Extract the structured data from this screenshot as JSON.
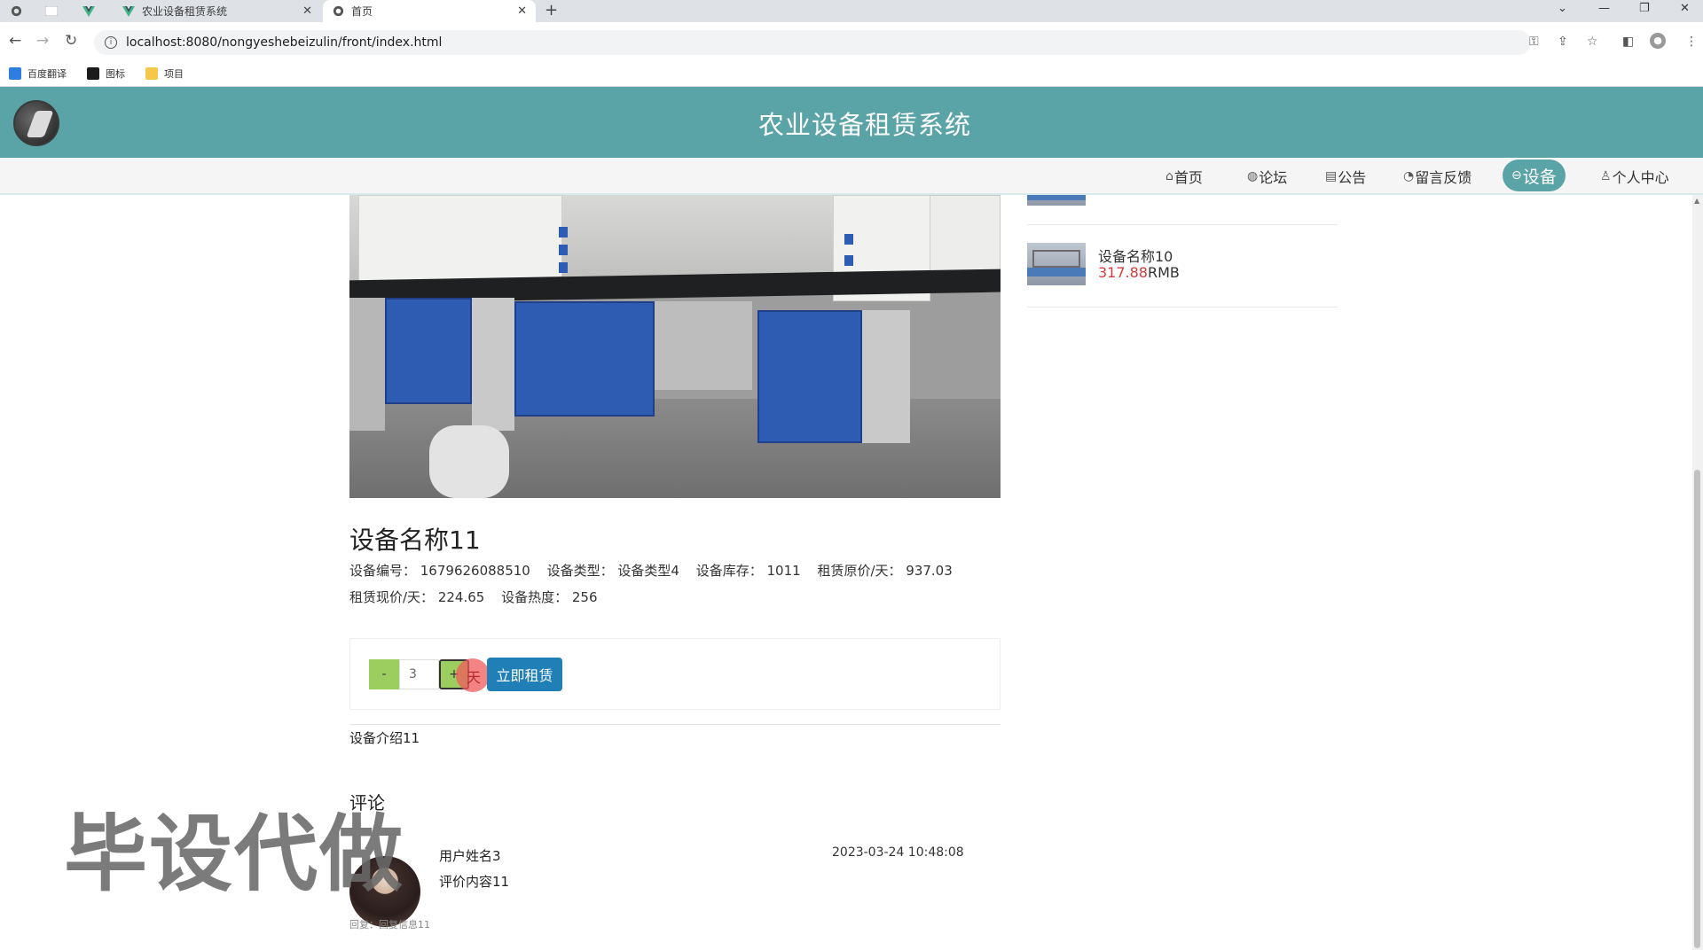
{
  "browser": {
    "tabs": [
      {
        "title": ""
      },
      {
        "title": ""
      },
      {
        "title": ""
      },
      {
        "title": "农业设备租赁系统"
      },
      {
        "title": "首页"
      }
    ],
    "new_tab": "+",
    "url": "localhost:8080/nongyeshebeizulin/front/index.html",
    "bookmarks": [
      {
        "label": "百度翻译"
      },
      {
        "label": "图标"
      },
      {
        "label": "项目"
      }
    ]
  },
  "site": {
    "title": "农业设备租赁系统",
    "nav": [
      {
        "label": "首页",
        "icon": "home-icon"
      },
      {
        "label": "论坛",
        "icon": "forum-icon"
      },
      {
        "label": "公告",
        "icon": "notice-icon"
      },
      {
        "label": "留言反馈",
        "icon": "feedback-icon"
      },
      {
        "label": "设备",
        "icon": "device-icon",
        "active": true
      },
      {
        "label": "个人中心",
        "icon": "user-icon"
      }
    ]
  },
  "product": {
    "name": "设备名称11",
    "meta_line1": [
      "设备编号： 1679626088510",
      "设备类型： 设备类型4",
      "设备库存： 1011",
      "租赁原价/天： 937.03"
    ],
    "meta_line2": [
      "租赁现价/天： 224.65",
      "设备热度： 256"
    ],
    "quantity": "3",
    "minus": "-",
    "plus": "+",
    "unit": "天",
    "rent_button": "立即租赁",
    "intro": "设备介绍11"
  },
  "comments": {
    "heading": "评论",
    "items": [
      {
        "user": "用户姓名3",
        "text": "评价内容11",
        "time": "2023-03-24 10:48:08",
        "reply": "回复：回复信息11"
      }
    ]
  },
  "sidebar": {
    "items": [
      {
        "name": "设备名称10",
        "price": "317.88",
        "currency": "RMB"
      }
    ]
  },
  "watermark": "毕设代做",
  "colors": {
    "header": "#5aa3a7",
    "active_nav": "#5aa3a7",
    "rent_button": "#1f7fb6",
    "qty_buttons": "#9ccd5f",
    "price": "#d93a3a"
  }
}
